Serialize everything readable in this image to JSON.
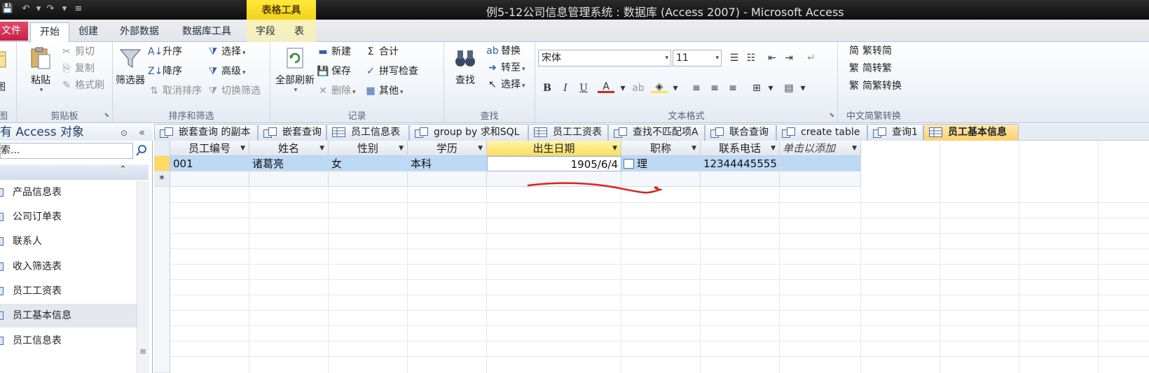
{
  "window": {
    "title": "例5-12公司信息管理系统 : 数据库 (Access 2007)  -  Microsoft Access",
    "context_tab_group": "表格工具"
  },
  "ribbon_tabs": [
    "文件",
    "开始",
    "创建",
    "外部数据",
    "数据库工具",
    "字段",
    "表"
  ],
  "ribbon": {
    "view": {
      "group_label": "图"
    },
    "clipboard": {
      "paste": "粘贴",
      "cut": "剪切",
      "copy": "复制",
      "format_painter": "格式刷",
      "group_label": "剪贴板"
    },
    "sort_filter": {
      "filter": "筛选器",
      "ascending": "升序",
      "descending": "降序",
      "remove_sort": "取消排序",
      "selection": "选择",
      "advanced": "高级",
      "toggle_filter": "切换筛选",
      "group_label": "排序和筛选"
    },
    "records": {
      "refresh_all": "全部刷新",
      "new": "新建",
      "save": "保存",
      "delete": "删除",
      "totals": "合计",
      "spelling": "拼写检查",
      "more": "其他",
      "group_label": "记录"
    },
    "find": {
      "find": "查找",
      "replace": "替换",
      "goto": "转至",
      "select": "选择",
      "group_label": "查找"
    },
    "text_format": {
      "font": "宋体",
      "size": "11",
      "bold": "B",
      "italic": "I",
      "underline": "U",
      "group_label": "文本格式"
    },
    "chinese_conversion": {
      "to_simplified": "繁转简",
      "to_traditional": "简转繁",
      "conversion": "简繁转换",
      "group_label": "中文简繁转换"
    }
  },
  "nav_pane": {
    "title": "有 Access 对象",
    "search_placeholder": "索...",
    "items": [
      "产品信息表",
      "公司订单表",
      "联系人",
      "收入筛选表",
      "员工工资表",
      "员工基本信息",
      "员工信息表"
    ],
    "selected": "员工基本信息"
  },
  "doc_tabs": [
    "嵌套查询 的副本",
    "嵌套查询",
    "员工信息表",
    "group by 求和SQL",
    "员工工资表",
    "查找不匹配项A",
    "联合查询",
    "create table",
    "查询1",
    "员工基本信息"
  ],
  "active_doc_tab": "员工基本信息",
  "datasheet": {
    "columns": [
      "员工编号",
      "姓名",
      "性别",
      "学历",
      "出生日期",
      "职称",
      "联系电话",
      "单击以添加"
    ],
    "rows": [
      [
        "001",
        "诸葛亮",
        "女",
        "本科",
        "1905/6/4",
        "理",
        "12344445555",
        ""
      ]
    ],
    "new_row_marker": "*",
    "highlighted_column": "出生日期"
  },
  "colors": {
    "file_tab": "#c81f46",
    "context_tab": "#f2d21a",
    "selected_row": "#bcd9f5",
    "active_doc_tab": "#ffcf6e",
    "annotation": "#e0201a"
  }
}
